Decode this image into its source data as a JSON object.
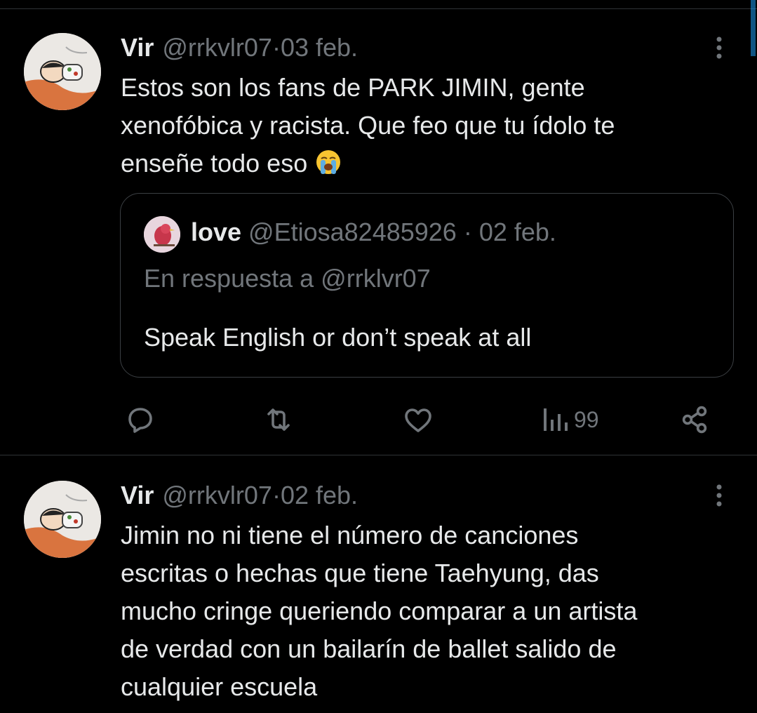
{
  "tweets": [
    {
      "name": "Vir",
      "handle": "@rrkvlr07",
      "sep": " · ",
      "date": "03 feb.",
      "lines": [
        "Estos son los fans de PARK JIMIN, gente",
        "xenofóbica y racista. Que feo que tu ídolo te",
        "enseñe todo eso"
      ],
      "emoji": "loudly-crying-face-emoji",
      "quote": {
        "name": "love",
        "handle": "@Etiosa82485926",
        "sep": " · ",
        "date": "02 feb.",
        "reply_prefix": "En respuesta a",
        "reply_to": "@rrklvr07",
        "text": "Speak English or don’t speak at all"
      },
      "actions": {
        "reply_icon": "reply-icon",
        "retweet_icon": "retweet-icon",
        "like_icon": "like-icon",
        "views_icon": "views-icon",
        "views_count": "99",
        "share_icon": "share-icon"
      }
    },
    {
      "name": "Vir",
      "handle": "@rrkvlr07",
      "sep": " · ",
      "date": "02 feb.",
      "lines": [
        "Jimin no ni tiene el número de canciones",
        "escritas o hechas que tiene Taehyung, das",
        "mucho cringe queriendo comparar a un artista",
        "de verdad con un bailarín de ballet salido de",
        "cualquier escuela"
      ]
    }
  ],
  "colors": {
    "background": "#000000",
    "text": "#e7e9ea",
    "secondary": "#71767b",
    "border": "#2f3336",
    "accent": "#1d9bf0"
  }
}
